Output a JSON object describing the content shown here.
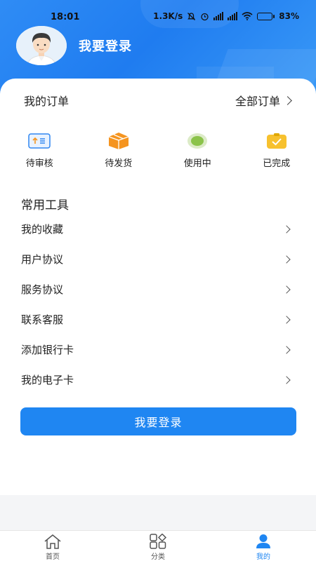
{
  "status_bar": {
    "time": "18:01",
    "network_speed": "1.3K/s",
    "battery": "83%"
  },
  "profile": {
    "login_title": "我要登录"
  },
  "orders": {
    "title": "我的订单",
    "all_orders": "全部订单",
    "items": [
      {
        "label": "待审核",
        "icon": "review-icon"
      },
      {
        "label": "待发货",
        "icon": "package-icon"
      },
      {
        "label": "使用中",
        "icon": "in-use-icon"
      },
      {
        "label": "已完成",
        "icon": "completed-icon"
      }
    ]
  },
  "tools": {
    "title": "常用工具",
    "items": [
      {
        "label": "我的收藏"
      },
      {
        "label": "用户协议"
      },
      {
        "label": "服务协议"
      },
      {
        "label": "联系客服"
      },
      {
        "label": "添加银行卡"
      },
      {
        "label": "我的电子卡"
      }
    ]
  },
  "login_button": "我要登录",
  "bottom_nav": {
    "items": [
      {
        "label": "首页",
        "icon": "home-icon",
        "active": false
      },
      {
        "label": "分类",
        "icon": "category-icon",
        "active": false
      },
      {
        "label": "我的",
        "icon": "profile-icon",
        "active": true
      }
    ]
  },
  "colors": {
    "accent": "#1f86f2",
    "header_gradient": "#2f8cf5",
    "package_orange": "#f5941f",
    "completed_yellow": "#f7c12e",
    "in_use_green": "#8bc34a"
  }
}
